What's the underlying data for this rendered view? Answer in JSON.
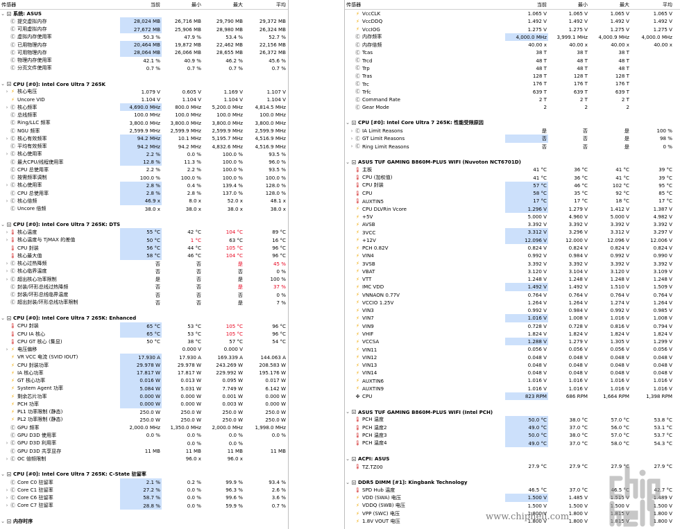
{
  "columns": {
    "sensor": "传感器",
    "current": "当前",
    "min": "最小",
    "max": "最大",
    "avg": "平均"
  },
  "icons": {
    "clock": "clock-icon",
    "bolt": "lightning-icon",
    "temp": "thermometer-icon",
    "fan": "fan-icon",
    "chip": "chip-icon",
    "collapse": "collapse-icon"
  },
  "left": [
    {
      "k": "g",
      "n": "系统: ASUS"
    },
    {
      "i": "clock",
      "n": "提交虚拟内存",
      "v": [
        "28,024 MB",
        "26,716 MB",
        "29,790 MB",
        "29,372 MB"
      ],
      "h": 1
    },
    {
      "i": "clock",
      "n": "可用虚拟内存",
      "v": [
        "27,672 MB",
        "25,906 MB",
        "28,980 MB",
        "26,324 MB"
      ],
      "h": 1
    },
    {
      "i": "clock",
      "n": "虚拟内存使用率",
      "v": [
        "50.3 %",
        "47.9 %",
        "53.4 %",
        "52.7 %"
      ]
    },
    {
      "i": "clock",
      "n": "已用物理内存",
      "v": [
        "20,464 MB",
        "19,872 MB",
        "22,462 MB",
        "22,156 MB"
      ],
      "h": 1
    },
    {
      "i": "clock",
      "n": "可用物理内存",
      "v": [
        "28,064 MB",
        "26,066 MB",
        "28,655 MB",
        "26,372 MB"
      ],
      "h": 1
    },
    {
      "i": "clock",
      "n": "物理内存使用率",
      "v": [
        "42.1 %",
        "40.9 %",
        "46.2 %",
        "45.6 %"
      ]
    },
    {
      "i": "clock",
      "n": "分页文件使用率",
      "v": [
        "0.7 %",
        "0.7 %",
        "0.7 %",
        "0.7 %"
      ]
    },
    {
      "k": "s"
    },
    {
      "k": "g",
      "n": "CPU [#0]: Intel Core Ultra 7 265K"
    },
    {
      "x": 1,
      "i": "bolt",
      "n": "核心电压",
      "v": [
        "1.079 V",
        "0.605 V",
        "1.169 V",
        "1.107 V"
      ]
    },
    {
      "i": "bolt",
      "n": "Uncore VID",
      "v": [
        "1.104 V",
        "1.104 V",
        "1.104 V",
        "1.104 V"
      ]
    },
    {
      "x": 1,
      "i": "clock",
      "n": "核心频率",
      "v": [
        "4,690.0 MHz",
        "800.0 MHz",
        "5,200.0 MHz",
        "4,814.5 MHz"
      ],
      "h": 1
    },
    {
      "i": "clock",
      "n": "总线频率",
      "v": [
        "100.0 MHz",
        "100.0 MHz",
        "100.0 MHz",
        "100.0 MHz"
      ]
    },
    {
      "i": "clock",
      "n": "Ring/LLC 频率",
      "v": [
        "3,800.0 MHz",
        "3,800.0 MHz",
        "3,800.0 MHz",
        "3,800.0 MHz"
      ]
    },
    {
      "i": "clock",
      "n": "NGU 频率",
      "v": [
        "2,599.9 MHz",
        "2,599.9 MHz",
        "2,599.9 MHz",
        "2,599.9 MHz"
      ]
    },
    {
      "x": 1,
      "i": "clock",
      "n": "核心有效频率",
      "v": [
        "94.2 MHz",
        "10.1 MHz",
        "5,195.7 MHz",
        "4,516.9 MHz"
      ],
      "h": 1
    },
    {
      "i": "clock",
      "n": "平均有效频率",
      "v": [
        "94.2 MHz",
        "94.2 MHz",
        "4,832.6 MHz",
        "4,516.9 MHz"
      ],
      "h": 1
    },
    {
      "x": 1,
      "i": "clock",
      "n": "核心使用率",
      "v": [
        "2.2 %",
        "0.0 %",
        "100.0 %",
        "93.5 %"
      ],
      "h": 1
    },
    {
      "i": "clock",
      "n": "最大CPU/线程使用率",
      "v": [
        "12.8 %",
        "11.3 %",
        "100.0 %",
        "96.0 %"
      ],
      "h": 1
    },
    {
      "i": "clock",
      "n": "CPU 总使用率",
      "v": [
        "2.2 %",
        "2.2 %",
        "100.0 %",
        "93.5 %"
      ]
    },
    {
      "i": "clock",
      "n": "按需频率调制",
      "v": [
        "100.0 %",
        "100.0 %",
        "100.0 %",
        "100.0 %"
      ]
    },
    {
      "x": 1,
      "i": "clock",
      "n": "核心使用率",
      "v": [
        "2.8 %",
        "0.4 %",
        "139.4 %",
        "128.0 %"
      ],
      "h": 1
    },
    {
      "i": "clock",
      "n": "CPU 总使用率",
      "v": [
        "2.8 %",
        "2.8 %",
        "137.0 %",
        "128.0 %"
      ],
      "h": 1
    },
    {
      "x": 1,
      "i": "clock",
      "n": "核心倍频",
      "v": [
        "46.9 x",
        "8.0 x",
        "52.0 x",
        "48.1 x"
      ],
      "h": 1
    },
    {
      "i": "clock",
      "n": "Uncore 倍频",
      "v": [
        "38.0 x",
        "38.0 x",
        "38.0 x",
        "38.0 x"
      ]
    },
    {
      "k": "s"
    },
    {
      "k": "g",
      "n": "CPU [#0]: Intel Core Ultra 7 265K: DTS"
    },
    {
      "x": 1,
      "i": "temp",
      "n": "核心温度",
      "v": [
        "55 °C",
        "42 °C",
        "104 °C",
        "89 °C"
      ],
      "h": 1,
      "r": [
        2
      ]
    },
    {
      "x": 1,
      "i": "temp",
      "n": "核心温度与 TjMAX 的差值",
      "v": [
        "50 °C",
        "1 °C",
        "63 °C",
        "16 °C"
      ],
      "h": 1,
      "r": [
        1
      ]
    },
    {
      "i": "temp",
      "n": "CPU 封装",
      "v": [
        "56 °C",
        "44 °C",
        "105 °C",
        "96 °C"
      ],
      "h": 1,
      "r": [
        2
      ]
    },
    {
      "i": "temp",
      "n": "核心最大值",
      "v": [
        "58 °C",
        "46 °C",
        "104 °C",
        "96 °C"
      ],
      "h": 1,
      "r": [
        2
      ]
    },
    {
      "x": 1,
      "i": "clock",
      "n": "核心过热降频",
      "v": [
        "否",
        "否",
        "是",
        "45 %"
      ],
      "r": [
        2,
        3
      ]
    },
    {
      "x": 1,
      "i": "clock",
      "n": "核心临界温度",
      "v": [
        "否",
        "否",
        "否",
        "0 %"
      ]
    },
    {
      "x": 1,
      "i": "clock",
      "n": "超出核心功率限制",
      "v": [
        "是",
        "否",
        "是",
        "100 %"
      ]
    },
    {
      "i": "clock",
      "n": "封装/环形总线过热降频",
      "v": [
        "否",
        "否",
        "是",
        "37 %"
      ],
      "r": [
        2,
        3
      ]
    },
    {
      "i": "clock",
      "n": "封装/环形总线临界温度",
      "v": [
        "否",
        "否",
        "否",
        "0 %"
      ]
    },
    {
      "i": "clock",
      "n": "超出封装/环形总线功率限制",
      "v": [
        "否",
        "否",
        "是",
        "7 %"
      ]
    },
    {
      "k": "s"
    },
    {
      "k": "g",
      "n": "CPU [#0]: Intel Core Ultra 7 265K: Enhanced"
    },
    {
      "i": "temp",
      "n": "CPU 封装",
      "v": [
        "65 °C",
        "53 °C",
        "105 °C",
        "96 °C"
      ],
      "h": 1,
      "r": [
        2
      ]
    },
    {
      "i": "temp",
      "n": "CPU IA 核心",
      "v": [
        "65 °C",
        "53 °C",
        "105 °C",
        "96 °C"
      ],
      "h": 1,
      "r": [
        2
      ]
    },
    {
      "i": "temp",
      "n": "CPU GT 核心 (集显)",
      "v": [
        "50 °C",
        "38 °C",
        "57 °C",
        "54 °C"
      ]
    },
    {
      "x": 1,
      "i": "bolt",
      "n": "电压偏移",
      "v": [
        "",
        "0.000 V",
        "0.000 V",
        ""
      ]
    },
    {
      "i": "bolt",
      "n": "VR VCC 电流 (SVID IOUT)",
      "v": [
        "17.930 A",
        "17.930 A",
        "169.339 A",
        "144.063 A"
      ],
      "h": 1
    },
    {
      "i": "bolt",
      "n": "CPU 封装功率",
      "v": [
        "29.978 W",
        "29.978 W",
        "243.269 W",
        "208.583 W"
      ],
      "h": 1
    },
    {
      "i": "bolt",
      "n": "IA 核心功率",
      "v": [
        "17.817 W",
        "17.817 W",
        "229.992 W",
        "195.176 W"
      ],
      "h": 1
    },
    {
      "i": "bolt",
      "n": "GT 核心功率",
      "v": [
        "0.016 W",
        "0.013 W",
        "0.095 W",
        "0.017 W"
      ],
      "h": 1
    },
    {
      "i": "bolt",
      "n": "System Agent 功率",
      "v": [
        "5.084 W",
        "5.031 W",
        "7.749 W",
        "6.142 W"
      ],
      "h": 1
    },
    {
      "i": "bolt",
      "n": "剩余芯片功率",
      "v": [
        "0.000 W",
        "0.000 W",
        "0.001 W",
        "0.000 W"
      ],
      "h": 1
    },
    {
      "i": "bolt",
      "n": "PCH 功率",
      "v": [
        "0.000 W",
        "0.000 W",
        "0.003 W",
        "0.000 W"
      ],
      "h": 1
    },
    {
      "i": "bolt",
      "n": "PL1 功率限制 (静态)",
      "v": [
        "250.0 W",
        "250.0 W",
        "250.0 W",
        "250.0 W"
      ]
    },
    {
      "i": "bolt",
      "n": "PL2 功率限制 (静态)",
      "v": [
        "250.0 W",
        "250.0 W",
        "250.0 W",
        "250.0 W"
      ]
    },
    {
      "i": "clock",
      "n": "GPU 频率",
      "v": [
        "2,000.0 MHz",
        "1,350.0 MHz",
        "2,000.0 MHz",
        "1,998.0 MHz"
      ]
    },
    {
      "i": "clock",
      "n": "GPU D3D 使用率",
      "v": [
        "0.0 %",
        "0.0 %",
        "0.0 %",
        "0.0 %"
      ]
    },
    {
      "x": 1,
      "i": "clock",
      "n": "GPU D3D 利用率",
      "v": [
        "",
        "0.0 %",
        "0.0 %",
        ""
      ]
    },
    {
      "i": "clock",
      "n": "GPU D3D 共享显存",
      "v": [
        "11 MB",
        "11 MB",
        "11 MB",
        "11 MB"
      ]
    },
    {
      "x": 1,
      "i": "clock",
      "n": "OC 倍频限制",
      "v": [
        "",
        "96.0 x",
        "96.0 x",
        ""
      ]
    },
    {
      "k": "s"
    },
    {
      "k": "g",
      "n": "CPU [#0]: Intel Core Ultra 7 265K: C-State 驻留率"
    },
    {
      "i": "clock",
      "n": "Core C0 驻留率",
      "v": [
        "2.1 %",
        "0.2 %",
        "99.9 %",
        "93.4 %"
      ],
      "h": 1
    },
    {
      "x": 1,
      "i": "clock",
      "n": "Core C1 驻留率",
      "v": [
        "27.2 %",
        "0.0 %",
        "96.3 %",
        "2.6 %"
      ],
      "h": 1
    },
    {
      "x": 1,
      "i": "clock",
      "n": "Core C6 驻留率",
      "v": [
        "58.7 %",
        "0.0 %",
        "99.6 %",
        "3.6 %"
      ],
      "h": 1
    },
    {
      "x": 1,
      "i": "clock",
      "n": "Core C7 驻留率",
      "v": [
        "28.8 %",
        "0.0 %",
        "59.9 %",
        "0.7 %"
      ],
      "h": 1
    },
    {
      "k": "s"
    },
    {
      "k": "g",
      "n": "内存时序"
    }
  ],
  "right": [
    {
      "i": "bolt",
      "n": "VccCLK",
      "v": [
        "1.065 V",
        "1.065 V",
        "1.065 V",
        "1.065 V"
      ]
    },
    {
      "i": "bolt",
      "n": "VccDDQ",
      "v": [
        "1.492 V",
        "1.492 V",
        "1.492 V",
        "1.492 V"
      ]
    },
    {
      "i": "bolt",
      "n": "VccIOG",
      "v": [
        "1.275 V",
        "1.275 V",
        "1.275 V",
        "1.275 V"
      ]
    },
    {
      "i": "clock",
      "n": "内存频率",
      "v": [
        "4,000.0 MHz",
        "3,999.1 MHz",
        "4,000.9 MHz",
        "4,000.0 MHz"
      ],
      "h": 1
    },
    {
      "i": "clock",
      "n": "内存倍频",
      "v": [
        "40.00 x",
        "40.00 x",
        "40.00 x",
        "40.00 x"
      ]
    },
    {
      "i": "clock",
      "n": "Tcas",
      "v": [
        "38 T",
        "38 T",
        "38 T",
        ""
      ]
    },
    {
      "i": "clock",
      "n": "Trcd",
      "v": [
        "48 T",
        "48 T",
        "48 T",
        ""
      ]
    },
    {
      "i": "clock",
      "n": "Trp",
      "v": [
        "48 T",
        "48 T",
        "48 T",
        ""
      ]
    },
    {
      "i": "clock",
      "n": "Tras",
      "v": [
        "128 T",
        "128 T",
        "128 T",
        ""
      ]
    },
    {
      "i": "clock",
      "n": "Trc",
      "v": [
        "176 T",
        "176 T",
        "176 T",
        ""
      ]
    },
    {
      "i": "clock",
      "n": "Trfc",
      "v": [
        "639 T",
        "639 T",
        "639 T",
        ""
      ]
    },
    {
      "i": "clock",
      "n": "Command Rate",
      "v": [
        "2 T",
        "2 T",
        "2 T",
        ""
      ]
    },
    {
      "i": "clock",
      "n": "Gear Mode",
      "v": [
        "2",
        "2",
        "2",
        ""
      ]
    },
    {
      "k": "s"
    },
    {
      "k": "g",
      "n": "CPU [#0]: Intel Core Ultra 7 265K: 性能受限原因"
    },
    {
      "x": 1,
      "i": "clock",
      "n": "IA Limit Reasons",
      "v": [
        "是",
        "否",
        "是",
        "100 %"
      ]
    },
    {
      "x": 1,
      "i": "clock",
      "n": "GT Limit Reasons",
      "v": [
        "否",
        "否",
        "是",
        "98 %"
      ],
      "h": 1
    },
    {
      "x": 1,
      "i": "clock",
      "n": "Ring Limit Reasons",
      "v": [
        "否",
        "否",
        "是",
        "0 %"
      ]
    },
    {
      "k": "s"
    },
    {
      "k": "g",
      "n": "ASUS TUF GAMING B860M-PLUS WIFI (Nuvoton NCT6701D)"
    },
    {
      "i": "temp",
      "n": "主板",
      "v": [
        "41 °C",
        "36 °C",
        "41 °C",
        "39 °C"
      ]
    },
    {
      "i": "temp",
      "n": "CPU (加权值)",
      "v": [
        "41 °C",
        "36 °C",
        "41 °C",
        "39 °C"
      ]
    },
    {
      "i": "temp",
      "n": "CPU 封装",
      "v": [
        "57 °C",
        "46 °C",
        "102 °C",
        "95 °C"
      ],
      "h": 1
    },
    {
      "i": "temp",
      "n": "CPU",
      "v": [
        "58 °C",
        "35 °C",
        "92 °C",
        "85 °C"
      ],
      "h": 1
    },
    {
      "i": "temp",
      "n": "AUXTIN5",
      "v": [
        "17 °C",
        "17 °C",
        "18 °C",
        "17 °C"
      ],
      "h": 1
    },
    {
      "i": "bolt",
      "n": "CPU DLVRin Vcore",
      "v": [
        "1.296 V",
        "1.279 V",
        "1.412 V",
        "1.387 V"
      ],
      "h": 1
    },
    {
      "i": "bolt",
      "n": "+5V",
      "v": [
        "5.000 V",
        "4.960 V",
        "5.000 V",
        "4.982 V"
      ]
    },
    {
      "i": "bolt",
      "n": "AVSB",
      "v": [
        "3.392 V",
        "3.392 V",
        "3.392 V",
        "3.392 V"
      ]
    },
    {
      "i": "bolt",
      "n": "3VCC",
      "v": [
        "3.312 V",
        "3.296 V",
        "3.312 V",
        "3.297 V"
      ],
      "h": 1
    },
    {
      "i": "bolt",
      "n": "+12V",
      "v": [
        "12.096 V",
        "12.000 V",
        "12.096 V",
        "12.006 V"
      ],
      "h": 1
    },
    {
      "i": "bolt",
      "n": "PCH 0.82V",
      "v": [
        "0.824 V",
        "0.824 V",
        "0.824 V",
        "0.824 V"
      ]
    },
    {
      "i": "bolt",
      "n": "VIN4",
      "v": [
        "0.992 V",
        "0.984 V",
        "0.992 V",
        "0.990 V"
      ]
    },
    {
      "i": "bolt",
      "n": "3VSB",
      "v": [
        "3.392 V",
        "3.392 V",
        "3.392 V",
        "3.392 V"
      ]
    },
    {
      "i": "bolt",
      "n": "VBAT",
      "v": [
        "3.120 V",
        "3.104 V",
        "3.120 V",
        "3.109 V"
      ]
    },
    {
      "i": "bolt",
      "n": "VTT",
      "v": [
        "1.248 V",
        "1.248 V",
        "1.248 V",
        "1.248 V"
      ]
    },
    {
      "i": "bolt",
      "n": "IMC VDD",
      "v": [
        "1.492 V",
        "1.492 V",
        "1.510 V",
        "1.509 V"
      ],
      "h": 1
    },
    {
      "i": "bolt",
      "n": "VNNAON 0.77V",
      "v": [
        "0.764 V",
        "0.764 V",
        "0.764 V",
        "0.764 V"
      ]
    },
    {
      "i": "bolt",
      "n": "VCCIO 1.25V",
      "v": [
        "1.264 V",
        "1.264 V",
        "1.274 V",
        "1.264 V"
      ]
    },
    {
      "i": "bolt",
      "n": "VIN3",
      "v": [
        "0.992 V",
        "0.984 V",
        "0.992 V",
        "0.985 V"
      ]
    },
    {
      "i": "bolt",
      "n": "VIN7",
      "v": [
        "1.016 V",
        "1.008 V",
        "1.016 V",
        "1.008 V"
      ],
      "h": 1
    },
    {
      "i": "bolt",
      "n": "VIN9",
      "v": [
        "0.728 V",
        "0.728 V",
        "0.816 V",
        "0.794 V"
      ]
    },
    {
      "i": "bolt",
      "n": "VHIF",
      "v": [
        "1.824 V",
        "1.824 V",
        "1.824 V",
        "1.824 V"
      ]
    },
    {
      "i": "bolt",
      "n": "VCCSA",
      "v": [
        "1.288 V",
        "1.279 V",
        "1.305 V",
        "1.299 V"
      ],
      "h": 1
    },
    {
      "i": "bolt",
      "n": "VIN11",
      "v": [
        "0.056 V",
        "0.056 V",
        "0.056 V",
        "0.056 V"
      ]
    },
    {
      "i": "bolt",
      "n": "VIN12",
      "v": [
        "0.048 V",
        "0.048 V",
        "0.048 V",
        "0.048 V"
      ]
    },
    {
      "i": "bolt",
      "n": "VIN13",
      "v": [
        "0.048 V",
        "0.048 V",
        "0.048 V",
        "0.048 V"
      ]
    },
    {
      "i": "bolt",
      "n": "VIN14",
      "v": [
        "0.048 V",
        "0.048 V",
        "0.048 V",
        "0.048 V"
      ]
    },
    {
      "i": "bolt",
      "n": "AUXTIN6",
      "v": [
        "1.016 V",
        "1.016 V",
        "1.016 V",
        "1.016 V"
      ]
    },
    {
      "i": "bolt",
      "n": "AUXTIN9",
      "v": [
        "1.016 V",
        "1.016 V",
        "1.016 V",
        "1.016 V"
      ]
    },
    {
      "i": "fan",
      "n": "CPU",
      "v": [
        "823 RPM",
        "686 RPM",
        "1,664 RPM",
        "1,398 RPM"
      ],
      "h": 1
    },
    {
      "k": "s"
    },
    {
      "k": "g",
      "n": "ASUS TUF GAMING B860M-PLUS WIFI (Intel PCH)"
    },
    {
      "i": "temp",
      "n": "PCH 温度",
      "v": [
        "50.0 °C",
        "38.0 °C",
        "57.0 °C",
        "53.8 °C"
      ],
      "h": 1
    },
    {
      "i": "temp",
      "n": "PCH 温度2",
      "v": [
        "49.0 °C",
        "37.0 °C",
        "56.0 °C",
        "53.1 °C"
      ],
      "h": 1
    },
    {
      "i": "temp",
      "n": "PCH 温度3",
      "v": [
        "50.0 °C",
        "38.0 °C",
        "57.0 °C",
        "53.7 °C"
      ],
      "h": 1
    },
    {
      "i": "temp",
      "n": "PCH 温度4",
      "v": [
        "49.0 °C",
        "37.0 °C",
        "58.0 °C",
        "54.3 °C"
      ],
      "h": 1
    },
    {
      "k": "s"
    },
    {
      "k": "g",
      "n": "ACPI: ASUS"
    },
    {
      "i": "temp",
      "n": "TZ.TZ00",
      "v": [
        "27.9 °C",
        "27.9 °C",
        "27.9 °C",
        "27.9 °C"
      ]
    },
    {
      "k": "s"
    },
    {
      "k": "g",
      "n": "DDR5 DIMM [#1]: Kingbank Technology"
    },
    {
      "i": "temp",
      "n": "SPD Hub 温度",
      "v": [
        "46.5 °C",
        "37.0 °C",
        "46.5 °C",
        "42.7 °C"
      ]
    },
    {
      "i": "bolt",
      "n": "VDD (SWA) 电压",
      "v": [
        "1.500 V",
        "1.485 V",
        "1.515 V",
        "1.489 V"
      ],
      "h": 1
    },
    {
      "i": "bolt",
      "n": "VDDQ (SWB) 电压",
      "v": [
        "1.500 V",
        "1.500 V",
        "1.500 V",
        "1.500 V"
      ]
    },
    {
      "i": "bolt",
      "n": "VPP (SWC) 电压",
      "v": [
        "1.800 V",
        "1.800 V",
        "1.815 V",
        "1.800 V"
      ]
    },
    {
      "i": "bolt",
      "n": "1.8V VOUT 电压",
      "v": [
        "1.800 V",
        "1.800 V",
        "1.815 V",
        "1.800 V"
      ]
    }
  ],
  "watermark": {
    "logo": "chip hell",
    "url": "www.chiphell.com"
  }
}
